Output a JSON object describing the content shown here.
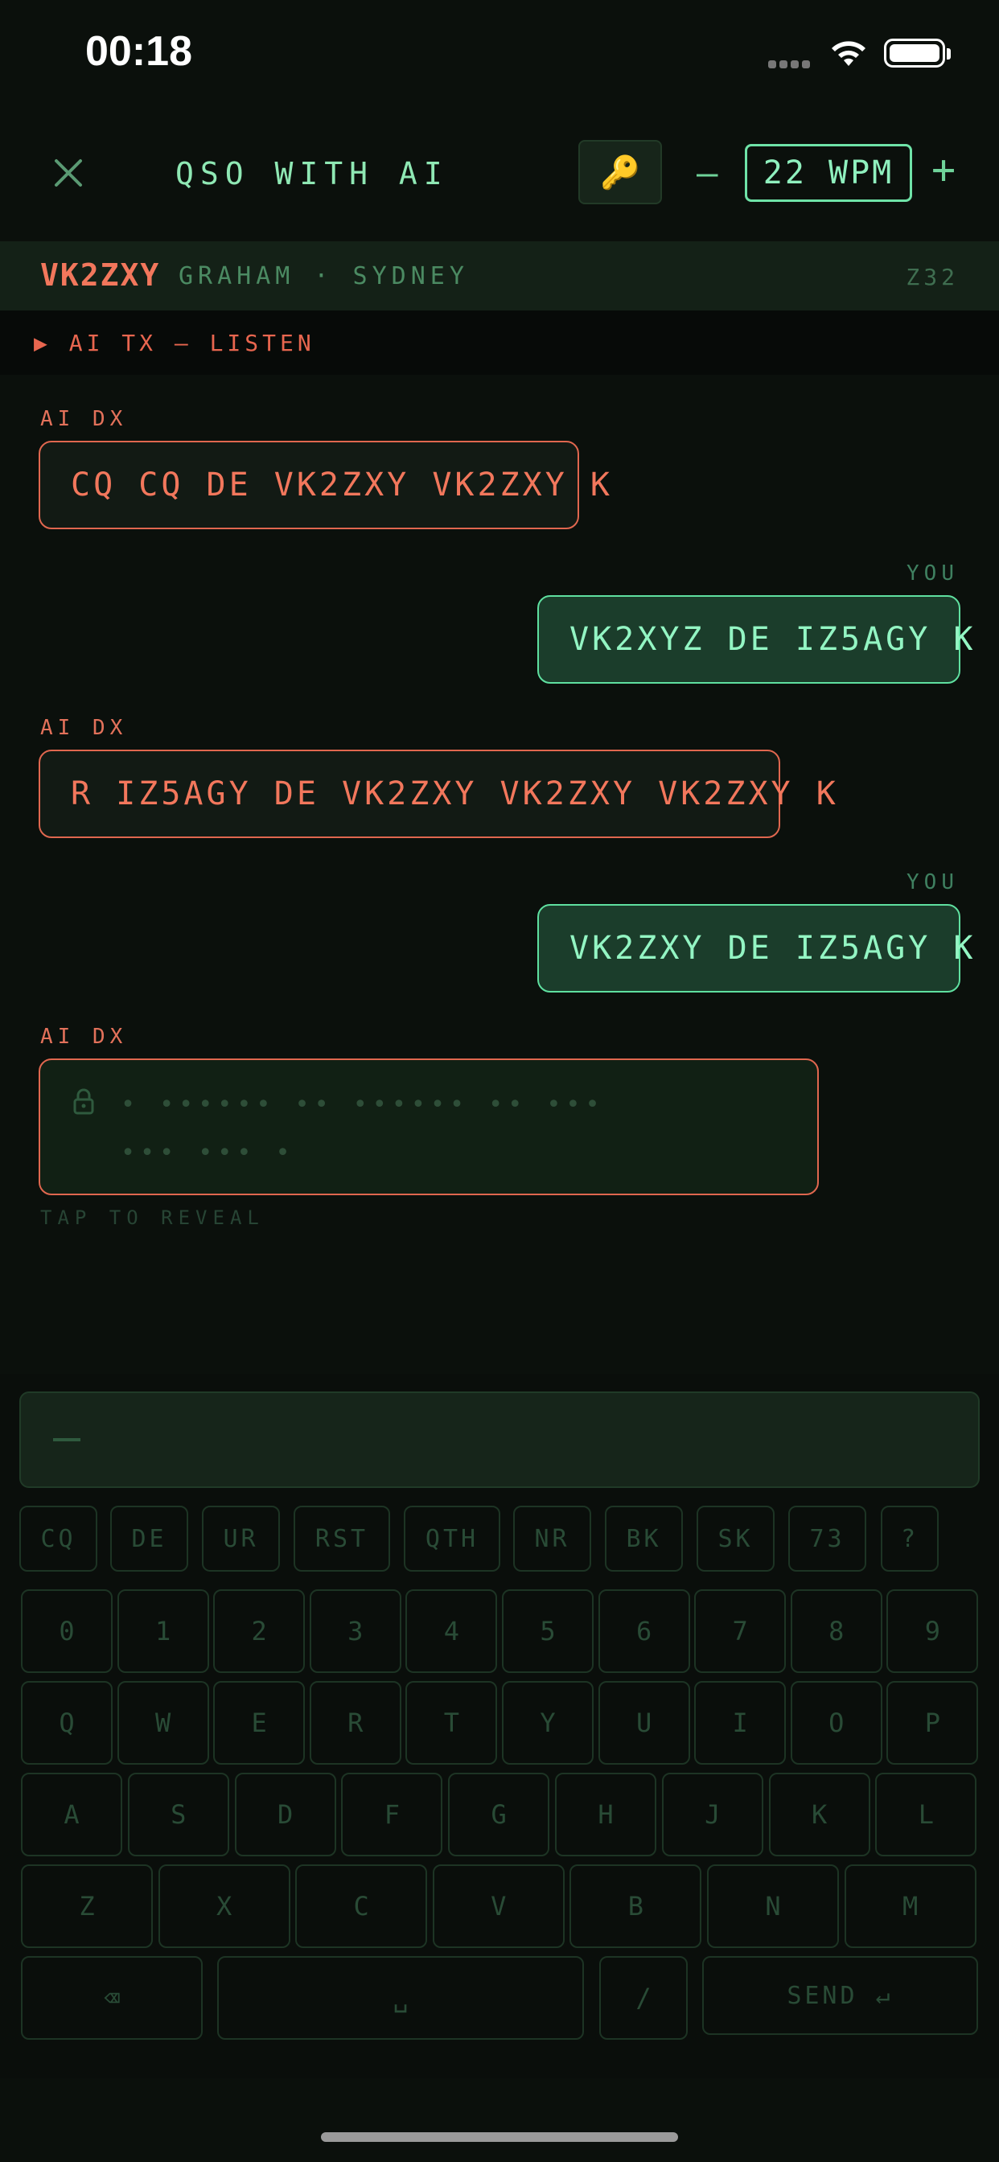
{
  "status": {
    "time": "00:18"
  },
  "header": {
    "title": "QSO WITH AI",
    "key_icon": "🔑",
    "minus": "—",
    "wpm": "22 WPM",
    "plus": "+"
  },
  "contact": {
    "callsign": "VK2ZXY",
    "name": "GRAHAM · SYDNEY",
    "zone": "Z32"
  },
  "listen": "▶ AI TX — LISTEN",
  "chat": [
    {
      "from": "AI DX",
      "text": "CQ CQ DE VK2ZXY VK2ZXY K"
    },
    {
      "from": "YOU",
      "text": "VK2XYZ DE IZ5AGY K"
    },
    {
      "from": "AI DX",
      "text": "R IZ5AGY DE VK2ZXY VK2ZXY VK2ZXY K"
    },
    {
      "from": "YOU",
      "text": "VK2ZXY DE IZ5AGY K"
    },
    {
      "from": "AI DX",
      "hidden_dots_line1": "•  ••••••  ••  ••••••  ••  •••",
      "hidden_dots_line2": "•••  •••  •"
    }
  ],
  "reveal": "TAP TO REVEAL",
  "keyboard": {
    "prosigns": [
      "CQ",
      "DE",
      "UR",
      "RST",
      "QTH",
      "NR",
      "BK",
      "SK",
      "73",
      "?"
    ],
    "row_numbers": [
      "0",
      "1",
      "2",
      "3",
      "4",
      "5",
      "6",
      "7",
      "8",
      "9"
    ],
    "row_q": [
      "Q",
      "W",
      "E",
      "R",
      "T",
      "Y",
      "U",
      "I",
      "O",
      "P"
    ],
    "row_a": [
      "A",
      "S",
      "D",
      "F",
      "G",
      "H",
      "J",
      "K",
      "L"
    ],
    "row_z": [
      "Z",
      "X",
      "C",
      "V",
      "B",
      "N",
      "M"
    ],
    "backspace": "⌫",
    "space": "␣",
    "slash": "/",
    "send": "SEND ↵"
  },
  "colors": {
    "accent_green": "#5fe0a0",
    "accent_orange": "#e0674f",
    "background": "#0b100c"
  }
}
